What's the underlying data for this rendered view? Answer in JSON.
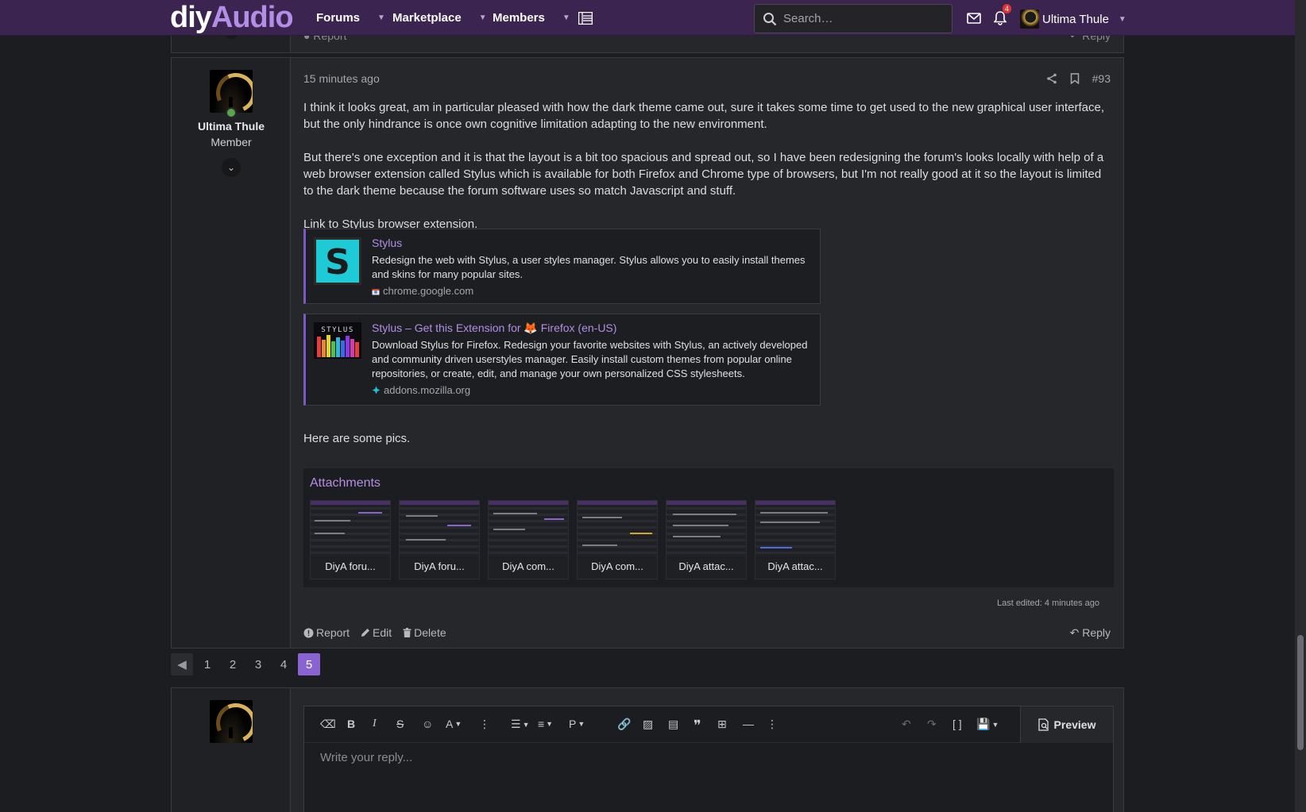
{
  "header": {
    "logo_part1": "diy",
    "logo_part2": "Audio",
    "nav": [
      {
        "label": "Forums"
      },
      {
        "label": "Marketplace"
      },
      {
        "label": "Members"
      }
    ],
    "search_placeholder": "Search…",
    "alert_count": "4",
    "username": "Ultima Thule",
    "colors": {
      "header_bg": "#3b2450",
      "accent": "#b38ee6",
      "active_page": "#8a63d2"
    }
  },
  "prev_post": {
    "report_label": "Report",
    "reply_label": "Reply"
  },
  "post": {
    "author": "Ultima Thule",
    "author_title": "Member",
    "time": "15 minutes ago",
    "number": "#93",
    "paragraphs": [
      "I think it looks great, am in particular pleased with how the dark theme came out, sure it takes some time to get used to the new graphical user interface, but the only hindrance is once own cognitive limitation adapting to the new environment.",
      "But there's one exception and it is that the layout is a bit too spacious and spread out, so I have been redesigning the forum's looks locally with help of a web browser extension called Stylus which is available for both Firefox and Chrome type of browsers, but I'm not really good at it so the layout is limited to the dark theme because the forum software uses so match Javascript and stuff.",
      "Link to Stylus browser extension."
    ],
    "unfurls": [
      {
        "title": "Stylus",
        "desc": "Redesign the web with Stylus, a user styles manager. Stylus allows you to easily install themes and skins for many popular sites.",
        "domain": "chrome.google.com",
        "thumb_icon": "stylus-s-logo"
      },
      {
        "title": "Stylus – Get this Extension for 🦊 Firefox (en-US)",
        "desc": "Download Stylus for Firefox. Redesign your favorite websites with Stylus, an actively developed and community driven userstyles manager. Easily install custom themes from popular online repositories, or create, edit, and manage your own personalized CSS stylesheets.",
        "domain": "addons.mozilla.org",
        "thumb_icon": "stylus-firefox-banner"
      }
    ],
    "pics_text": "Here are some pics.",
    "attachments_title": "Attachments",
    "attachments": [
      {
        "label": "DiyA foru..."
      },
      {
        "label": "DiyA foru..."
      },
      {
        "label": "DiyA com..."
      },
      {
        "label": "DiyA com..."
      },
      {
        "label": "DiyA attac..."
      },
      {
        "label": "DiyA attac..."
      }
    ],
    "last_edited": "Last edited: 4 minutes ago",
    "actions": {
      "report": "Report",
      "edit": "Edit",
      "delete": "Delete",
      "reply": "Reply"
    }
  },
  "pagination": {
    "pages": [
      "1",
      "2",
      "3",
      "4",
      "5"
    ],
    "current": "5"
  },
  "editor": {
    "placeholder": "Write your reply...",
    "preview_label": "Preview"
  }
}
